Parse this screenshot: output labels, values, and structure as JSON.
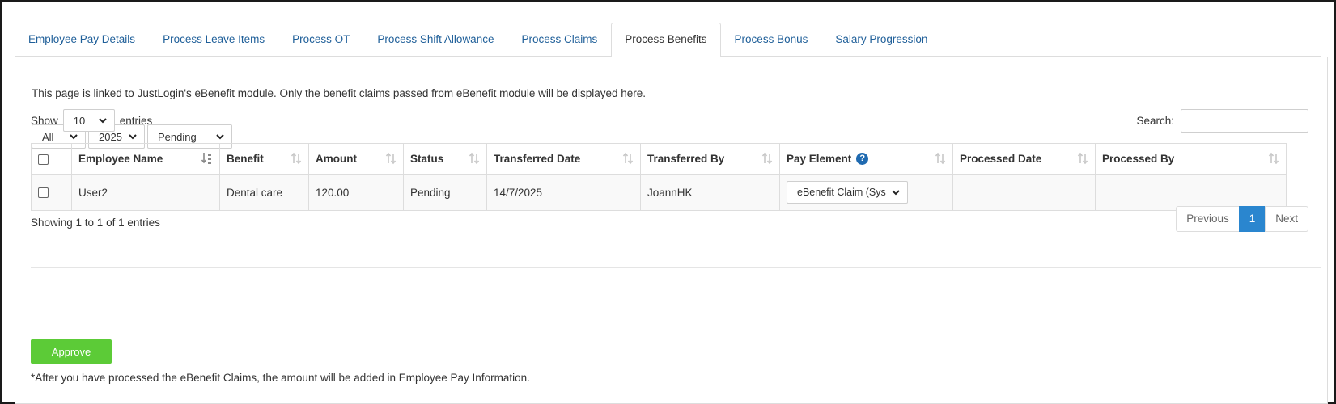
{
  "tabs": [
    {
      "label": "Employee Pay Details"
    },
    {
      "label": "Process Leave Items"
    },
    {
      "label": "Process OT"
    },
    {
      "label": "Process Shift Allowance"
    },
    {
      "label": "Process Claims"
    },
    {
      "label": "Process Benefits",
      "active": true
    },
    {
      "label": "Process Bonus"
    },
    {
      "label": "Salary Progression"
    }
  ],
  "info_text": "This page is linked to JustLogin's eBenefit module. Only the benefit claims passed from eBenefit module will be displayed here.",
  "filters": {
    "scope": "All",
    "year": "2025",
    "status": "Pending"
  },
  "length_menu": {
    "show_label": "Show",
    "value": "10",
    "entries_label": "entries"
  },
  "search": {
    "label": "Search:",
    "value": ""
  },
  "table": {
    "headers": {
      "employee_name": "Employee Name",
      "benefit": "Benefit",
      "amount": "Amount",
      "status": "Status",
      "transferred_date": "Transferred Date",
      "transferred_by": "Transferred By",
      "pay_element": "Pay Element",
      "processed_date": "Processed Date",
      "processed_by": "Processed By"
    },
    "rows": [
      {
        "employee_name": "User2",
        "benefit": "Dental care",
        "amount": "120.00",
        "status": "Pending",
        "transferred_date": "14/7/2025",
        "transferred_by": "JoannHK",
        "pay_element": "eBenefit Claim (Sys",
        "processed_date": "",
        "processed_by": ""
      }
    ]
  },
  "info_footer": "Showing 1 to 1 of 1 entries",
  "pagination": {
    "previous": "Previous",
    "current": "1",
    "next": "Next"
  },
  "approve_label": "Approve",
  "note": "*After you have processed the eBenefit Claims, the amount will be added in Employee Pay Information.",
  "colors": {
    "link": "#1f5f99",
    "approve": "#5ccb37",
    "page_active": "#2a86cf",
    "help_icon": "#1f6ab0"
  }
}
